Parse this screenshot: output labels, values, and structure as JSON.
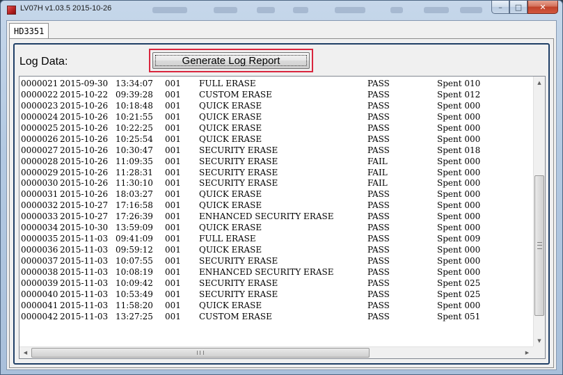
{
  "window": {
    "title": "LV07H v1.03.5 2015-10-26",
    "minimize_glyph": "–",
    "maximize_glyph": "□",
    "close_glyph": "✕"
  },
  "tab": {
    "label": "HD3351"
  },
  "log": {
    "label": "Log Data:",
    "generate_button": "Generate Log Report",
    "rows": [
      {
        "id": "0000021",
        "date": "2015-09-30",
        "time": "13:34:07",
        "code": "001",
        "op": "FULL ERASE",
        "result": "PASS",
        "spent": "Spent 010"
      },
      {
        "id": "0000022",
        "date": "2015-10-22",
        "time": "09:39:28",
        "code": "001",
        "op": "CUSTOM ERASE",
        "result": "PASS",
        "spent": "Spent 012"
      },
      {
        "id": "0000023",
        "date": "2015-10-26",
        "time": "10:18:48",
        "code": "001",
        "op": "QUICK ERASE",
        "result": "PASS",
        "spent": "Spent 000"
      },
      {
        "id": "0000024",
        "date": "2015-10-26",
        "time": "10:21:55",
        "code": "001",
        "op": "QUICK ERASE",
        "result": "PASS",
        "spent": "Spent 000"
      },
      {
        "id": "0000025",
        "date": "2015-10-26",
        "time": "10:22:25",
        "code": "001",
        "op": "QUICK ERASE",
        "result": "PASS",
        "spent": "Spent 000"
      },
      {
        "id": "0000026",
        "date": "2015-10-26",
        "time": "10:25:54",
        "code": "001",
        "op": "QUICK ERASE",
        "result": "PASS",
        "spent": "Spent 000"
      },
      {
        "id": "0000027",
        "date": "2015-10-26",
        "time": "10:30:47",
        "code": "001",
        "op": "SECURITY ERASE",
        "result": "PASS",
        "spent": "Spent 018"
      },
      {
        "id": "0000028",
        "date": "2015-10-26",
        "time": "11:09:35",
        "code": "001",
        "op": "SECURITY ERASE",
        "result": "FAIL",
        "spent": "Spent 000"
      },
      {
        "id": "0000029",
        "date": "2015-10-26",
        "time": "11:28:31",
        "code": "001",
        "op": "SECURITY ERASE",
        "result": "FAIL",
        "spent": "Spent 000"
      },
      {
        "id": "0000030",
        "date": "2015-10-26",
        "time": "11:30:10",
        "code": "001",
        "op": "SECURITY ERASE",
        "result": "FAIL",
        "spent": "Spent 000"
      },
      {
        "id": "0000031",
        "date": "2015-10-26",
        "time": "18:03:27",
        "code": "001",
        "op": "QUICK ERASE",
        "result": "PASS",
        "spent": "Spent 000"
      },
      {
        "id": "0000032",
        "date": "2015-10-27",
        "time": "17:16:58",
        "code": "001",
        "op": "QUICK ERASE",
        "result": "PASS",
        "spent": "Spent 000"
      },
      {
        "id": "0000033",
        "date": "2015-10-27",
        "time": "17:26:39",
        "code": "001",
        "op": "ENHANCED SECURITY ERASE",
        "result": "PASS",
        "spent": "Spent 000"
      },
      {
        "id": "0000034",
        "date": "2015-10-30",
        "time": "13:59:09",
        "code": "001",
        "op": "QUICK ERASE",
        "result": "PASS",
        "spent": "Spent 000"
      },
      {
        "id": "0000035",
        "date": "2015-11-03",
        "time": "09:41:09",
        "code": "001",
        "op": "FULL ERASE",
        "result": "PASS",
        "spent": "Spent 009"
      },
      {
        "id": "0000036",
        "date": "2015-11-03",
        "time": "09:59:12",
        "code": "001",
        "op": "QUICK ERASE",
        "result": "PASS",
        "spent": "Spent 000"
      },
      {
        "id": "0000037",
        "date": "2015-11-03",
        "time": "10:07:55",
        "code": "001",
        "op": "SECURITY ERASE",
        "result": "PASS",
        "spent": "Spent 000"
      },
      {
        "id": "0000038",
        "date": "2015-11-03",
        "time": "10:08:19",
        "code": "001",
        "op": "ENHANCED SECURITY ERASE",
        "result": "PASS",
        "spent": "Spent 000"
      },
      {
        "id": "0000039",
        "date": "2015-11-03",
        "time": "10:09:42",
        "code": "001",
        "op": "SECURITY ERASE",
        "result": "PASS",
        "spent": "Spent 025"
      },
      {
        "id": "0000040",
        "date": "2015-11-03",
        "time": "10:53:49",
        "code": "001",
        "op": "SECURITY ERASE",
        "result": "PASS",
        "spent": "Spent 025"
      },
      {
        "id": "0000041",
        "date": "2015-11-03",
        "time": "11:58:20",
        "code": "001",
        "op": "QUICK ERASE",
        "result": "PASS",
        "spent": "Spent 000"
      },
      {
        "id": "0000042",
        "date": "2015-11-03",
        "time": "13:27:25",
        "code": "001",
        "op": "CUSTOM ERASE",
        "result": "PASS",
        "spent": "Spent 051"
      }
    ]
  },
  "scrollbars": {
    "up_glyph": "▲",
    "down_glyph": "▼",
    "left_glyph": "◀",
    "right_glyph": "▶",
    "vertical_position": 0.62,
    "horizontal_position": 0.0
  },
  "colors": {
    "highlight": "#d9263e",
    "group_border": "#1f3f66",
    "app_icon": "#c62828"
  }
}
